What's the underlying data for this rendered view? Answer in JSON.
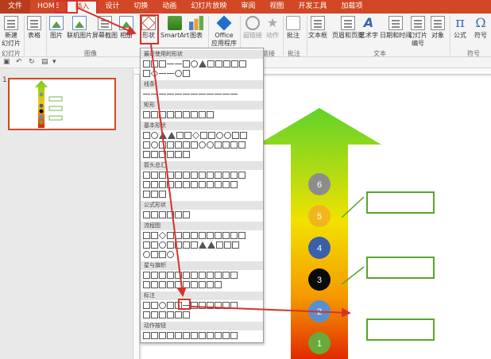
{
  "tabs": [
    {
      "label": "文件",
      "kind": "file"
    },
    {
      "label": "HOME",
      "kind": "normal"
    },
    {
      "label": "插入",
      "kind": "active"
    },
    {
      "label": "设计",
      "kind": "normal"
    },
    {
      "label": "切换",
      "kind": "normal"
    },
    {
      "label": "动画",
      "kind": "normal"
    },
    {
      "label": "幻灯片放映",
      "kind": "normal"
    },
    {
      "label": "审阅",
      "kind": "normal"
    },
    {
      "label": "视图",
      "kind": "normal"
    },
    {
      "label": "开发工具",
      "kind": "normal"
    },
    {
      "label": "加载项",
      "kind": "normal"
    }
  ],
  "ribbon": {
    "new_slide": "新建\n幻灯片",
    "table": "表格",
    "picture": "图片",
    "online_picture": "联机图片",
    "screenshot": "屏幕截图",
    "album": "相册",
    "shapes": "形状",
    "smartart": "SmartArt",
    "chart": "图表",
    "office_apps": "Office\n应用程序",
    "hyperlink": "超链接",
    "action": "动作",
    "comment": "批注",
    "textbox": "文本框",
    "header_footer": "页眉和页脚",
    "wordart": "艺术字",
    "datetime": "日期和时间",
    "slide_number": "幻灯片\n编号",
    "object": "对象",
    "equation": "公式",
    "symbol": "符号",
    "groups": {
      "slides": "幻灯片",
      "images": "图像",
      "links": "链接",
      "comments": "批注",
      "text": "文本",
      "symbols": "符号"
    }
  },
  "slide_number": "1",
  "dropdown": {
    "sections": [
      "最近使用的形状",
      "线条",
      "矩形",
      "基本形状",
      "箭头总汇",
      "公式形状",
      "流程图",
      "星与旗帜",
      "标注",
      "动作按钮"
    ]
  },
  "arrow_circles": [
    {
      "label": "6",
      "color": "#8c8c8c"
    },
    {
      "label": "5",
      "color": "#f2b61d"
    },
    {
      "label": "4",
      "color": "#3b5fa8"
    },
    {
      "label": "3",
      "color": "#0a0a0a"
    },
    {
      "label": "2",
      "color": "#5b8fcc"
    },
    {
      "label": "1",
      "color": "#6aaa3a"
    }
  ],
  "colors": {
    "accent": "#d24726",
    "annotation_red": "#d6322a",
    "callout_green": "#5aa52a"
  }
}
